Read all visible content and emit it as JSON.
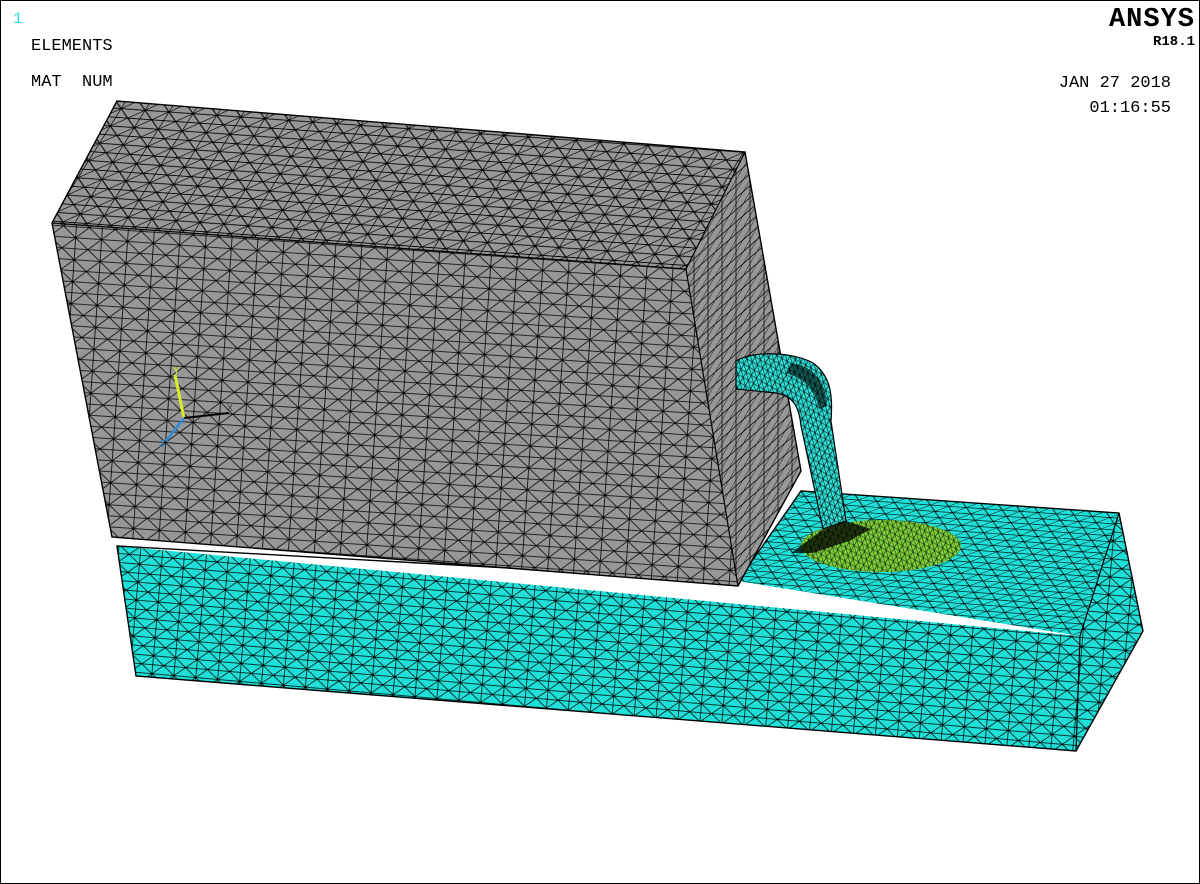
{
  "window": {
    "number": "1",
    "plot_type": "ELEMENTS",
    "numbering": "MAT  NUM",
    "brand": "ANSYS",
    "version": "R18.1",
    "date": "JAN 27 2018",
    "time": "01:16:55"
  },
  "triad": {
    "label_y": "Y",
    "label_x": "X",
    "label_z": "Z"
  },
  "colors": {
    "background": "#ffffff",
    "material_block": "#979797",
    "material_base": "#1fe0d8",
    "material_pipe": "#2ee0d8",
    "material_weld": "#7fd23a",
    "mesh_lines": "#000000",
    "window_number": "#33e0e0"
  },
  "icons": {
    "triad": "xyz-axis-triad-icon"
  }
}
